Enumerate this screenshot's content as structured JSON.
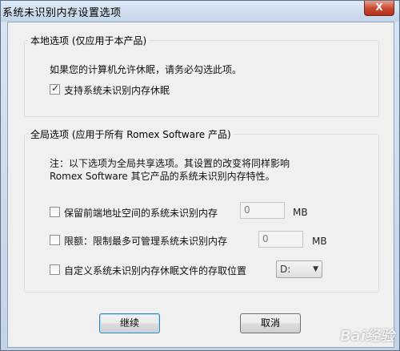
{
  "window": {
    "title": "系统未识别内存设置选项",
    "close_glyph": "X"
  },
  "local_group": {
    "legend": "本地选项 (仅应用于本产品)",
    "note": "如果您的计算机允许休眠，请务必勾选此项。",
    "hibernate_checkbox_label": "支持系统未识别内存休眠",
    "hibernate_checked": true
  },
  "global_group": {
    "legend": "全局选项 (应用于所有 Romex Software 产品)",
    "note_line1": "注：以下选项为全局共享选项。其设置的改变将同样影响",
    "note_line2": "Romex Software 其它产品的系统未识别内存特性。",
    "reserve": {
      "label": "保留前端地址空间的系统未识别内存",
      "checked": false,
      "value": "0",
      "unit": "MB"
    },
    "limit": {
      "label": "限额：限制最多可管理系统未识别内存",
      "checked": false,
      "value": "0",
      "unit": "MB"
    },
    "custom_location": {
      "label": "自定义系统未识别内存休眠文件的存取位置",
      "checked": false,
      "drive": "D:"
    }
  },
  "buttons": {
    "continue": "继续",
    "cancel": "取消"
  },
  "watermark": "Bai经验"
}
